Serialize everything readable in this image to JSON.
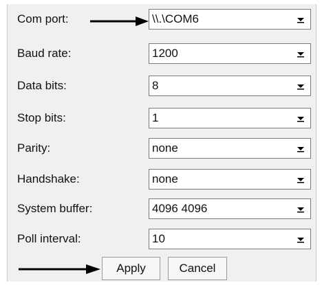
{
  "settings": [
    {
      "label": "Com port:",
      "value": "\\\\.\\COM6",
      "icon": "chevron-down-icon"
    },
    {
      "label": "Baud rate:",
      "value": "1200",
      "icon": "chevron-down-icon"
    },
    {
      "label": "Data bits:",
      "value": "8",
      "icon": "chevron-down-icon"
    },
    {
      "label": "Stop bits:",
      "value": "1",
      "icon": "chevron-down-icon"
    },
    {
      "label": "Parity:",
      "value": "none",
      "icon": "chevron-down-icon"
    },
    {
      "label": "Handshake:",
      "value": "none",
      "icon": "chevron-down-icon"
    },
    {
      "label": "System buffer:",
      "value": "4096 4096",
      "icon": "chevron-down-icon"
    },
    {
      "label": "Poll interval:",
      "value": "10",
      "icon": "chevron-down-icon"
    }
  ],
  "buttons": {
    "apply_label": "Apply",
    "cancel_label": "Cancel"
  },
  "annotations": {
    "arrow_icon": "right-arrow-icon",
    "color": "#000000"
  },
  "colors": {
    "panel_background": "#f0f0f0",
    "field_background": "#ffffff",
    "field_border": "#7a7a7a"
  }
}
